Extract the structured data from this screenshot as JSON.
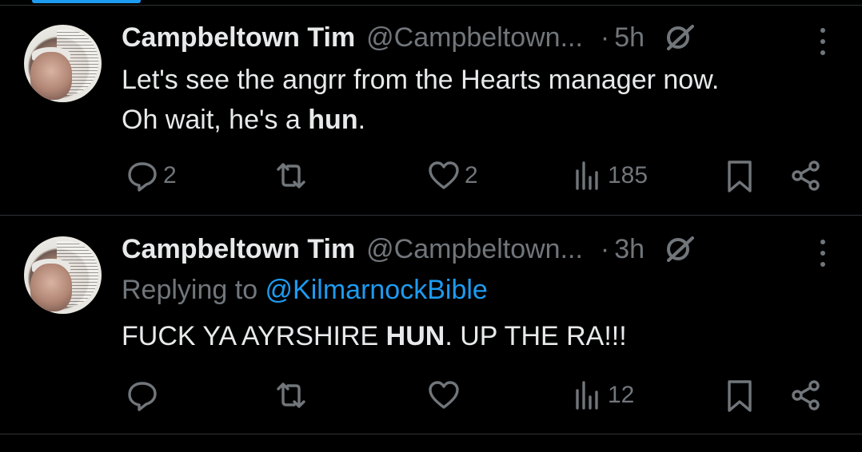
{
  "tweets": [
    {
      "author_name": "Campbeltown Tim",
      "handle": "@Campbeltown...",
      "dot": "·",
      "time": "5h",
      "text_line1": "Let's see the angrr from the Hearts manager now.",
      "text_line2_prefix": "Oh wait, he's a ",
      "text_line2_bold": "hun",
      "text_line2_suffix": ".",
      "replies": "2",
      "reposts": "",
      "likes": "2",
      "views": "185"
    },
    {
      "author_name": "Campbeltown Tim",
      "handle": "@Campbeltown...",
      "dot": "·",
      "time": "3h",
      "replying_label": "Replying to ",
      "replying_mention": "@KilmarnockBible",
      "text_prefix": "FUCK YA AYRSHIRE ",
      "text_bold": "HUN",
      "text_suffix": ". UP THE RA!!!",
      "replies": "",
      "reposts": "",
      "likes": "",
      "views": "12"
    }
  ],
  "colors": {
    "background": "#000000",
    "text_primary": "#e7e9ea",
    "text_secondary": "#71767b",
    "accent": "#1d9bf0",
    "divider": "#2f3336"
  },
  "icons": [
    "reply-icon",
    "repost-icon",
    "like-icon",
    "views-icon",
    "bookmark-icon",
    "share-icon",
    "grok-icon",
    "more-icon"
  ]
}
